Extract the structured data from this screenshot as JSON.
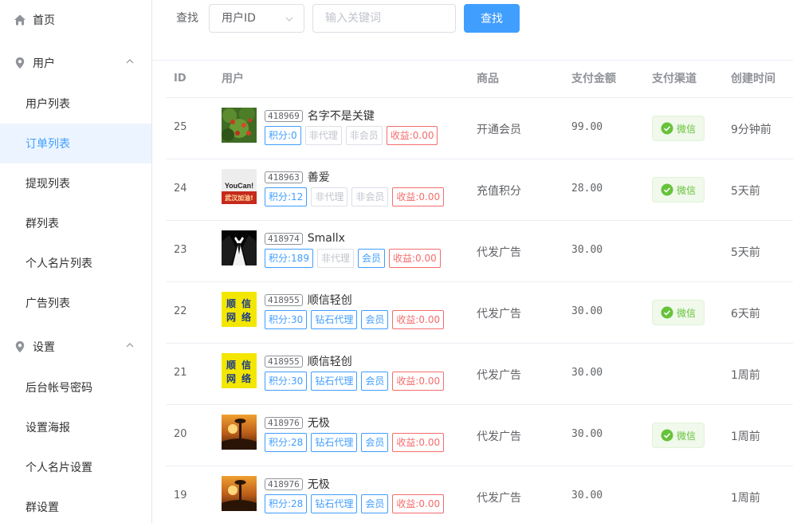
{
  "sidebar": {
    "items": [
      {
        "label": "首页",
        "icon": "home-icon"
      },
      {
        "label": "用户",
        "icon": "location-icon",
        "expanded": true
      },
      {
        "label": "用户列表"
      },
      {
        "label": "订单列表",
        "active": true
      },
      {
        "label": "提现列表"
      },
      {
        "label": "群列表"
      },
      {
        "label": "个人名片列表"
      },
      {
        "label": "广告列表"
      },
      {
        "label": "设置",
        "icon": "location-icon",
        "expanded": true
      },
      {
        "label": "后台帐号密码"
      },
      {
        "label": "设置海报"
      },
      {
        "label": "个人名片设置"
      },
      {
        "label": "群设置"
      }
    ]
  },
  "search": {
    "label": "查找",
    "select_value": "用户ID",
    "placeholder": "输入关键词",
    "button": "查找"
  },
  "table": {
    "headers": {
      "id": "ID",
      "user": "用户",
      "product": "商品",
      "amount": "支付金额",
      "channel": "支付渠道",
      "created": "创建时间"
    },
    "rows": [
      {
        "id": "25",
        "avatar": "fruit-tree",
        "uid": "418969",
        "name": "名字不是关键",
        "points": "积分:0",
        "agent": "非代理",
        "agent_active": false,
        "member": "非会员",
        "member_active": false,
        "income": "收益:0.00",
        "product": "开通会员",
        "amount": "99.00",
        "channel": "微信",
        "created": "9分钟前"
      },
      {
        "id": "24",
        "avatar": "youcan",
        "uid": "418963",
        "name": "善爱",
        "points": "积分:12",
        "agent": "非代理",
        "agent_active": false,
        "member": "非会员",
        "member_active": false,
        "income": "收益:0.00",
        "product": "充值积分",
        "amount": "28.00",
        "channel": "微信",
        "created": "5天前"
      },
      {
        "id": "23",
        "avatar": "suit",
        "uid": "418974",
        "name": "Smallx",
        "points": "积分:189",
        "agent": "非代理",
        "agent_active": false,
        "member": "会员",
        "member_active": true,
        "income": "收益:0.00",
        "product": "代发广告",
        "amount": "30.00",
        "channel": "",
        "created": "5天前"
      },
      {
        "id": "22",
        "avatar": "shunxin",
        "uid": "418955",
        "name": "顺信轻创",
        "points": "积分:30",
        "agent": "钻石代理",
        "agent_active": true,
        "member": "会员",
        "member_active": true,
        "income": "收益:0.00",
        "product": "代发广告",
        "amount": "30.00",
        "channel": "微信",
        "created": "6天前"
      },
      {
        "id": "21",
        "avatar": "shunxin",
        "uid": "418955",
        "name": "顺信轻创",
        "points": "积分:30",
        "agent": "钻石代理",
        "agent_active": true,
        "member": "会员",
        "member_active": true,
        "income": "收益:0.00",
        "product": "代发广告",
        "amount": "30.00",
        "channel": "",
        "created": "1周前"
      },
      {
        "id": "20",
        "avatar": "sunset",
        "uid": "418976",
        "name": "无极",
        "points": "积分:28",
        "agent": "钻石代理",
        "agent_active": true,
        "member": "会员",
        "member_active": true,
        "income": "收益:0.00",
        "product": "代发广告",
        "amount": "30.00",
        "channel": "微信",
        "created": "1周前"
      },
      {
        "id": "19",
        "avatar": "sunset",
        "uid": "418976",
        "name": "无极",
        "points": "积分:28",
        "agent": "钻石代理",
        "agent_active": true,
        "member": "会员",
        "member_active": true,
        "income": "收益:0.00",
        "product": "代发广告",
        "amount": "30.00",
        "channel": "",
        "created": "1周前"
      }
    ]
  },
  "colors": {
    "accent": "#409eff",
    "wechat": "#67c23a",
    "danger": "#f56c6c",
    "muted": "#c0c4cc"
  },
  "avatar_text": {
    "youcan_main": "YouCan!",
    "youcan_sub": "武汉加油!",
    "shunxin": [
      "顺",
      "信",
      "网",
      "络"
    ]
  }
}
